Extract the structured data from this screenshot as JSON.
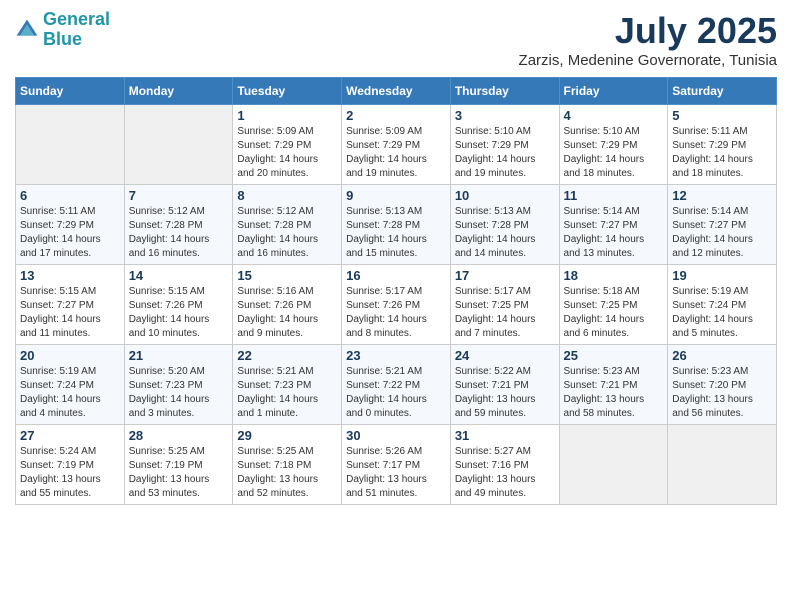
{
  "logo": {
    "line1": "General",
    "line2": "Blue"
  },
  "title": "July 2025",
  "location": "Zarzis, Medenine Governorate, Tunisia",
  "days_of_week": [
    "Sunday",
    "Monday",
    "Tuesday",
    "Wednesday",
    "Thursday",
    "Friday",
    "Saturday"
  ],
  "weeks": [
    [
      {
        "day": "",
        "empty": true
      },
      {
        "day": "",
        "empty": true
      },
      {
        "day": "1",
        "sunrise": "5:09 AM",
        "sunset": "7:29 PM",
        "daylight": "14 hours and 20 minutes."
      },
      {
        "day": "2",
        "sunrise": "5:09 AM",
        "sunset": "7:29 PM",
        "daylight": "14 hours and 19 minutes."
      },
      {
        "day": "3",
        "sunrise": "5:10 AM",
        "sunset": "7:29 PM",
        "daylight": "14 hours and 19 minutes."
      },
      {
        "day": "4",
        "sunrise": "5:10 AM",
        "sunset": "7:29 PM",
        "daylight": "14 hours and 18 minutes."
      },
      {
        "day": "5",
        "sunrise": "5:11 AM",
        "sunset": "7:29 PM",
        "daylight": "14 hours and 18 minutes."
      }
    ],
    [
      {
        "day": "6",
        "sunrise": "5:11 AM",
        "sunset": "7:29 PM",
        "daylight": "14 hours and 17 minutes."
      },
      {
        "day": "7",
        "sunrise": "5:12 AM",
        "sunset": "7:28 PM",
        "daylight": "14 hours and 16 minutes."
      },
      {
        "day": "8",
        "sunrise": "5:12 AM",
        "sunset": "7:28 PM",
        "daylight": "14 hours and 16 minutes."
      },
      {
        "day": "9",
        "sunrise": "5:13 AM",
        "sunset": "7:28 PM",
        "daylight": "14 hours and 15 minutes."
      },
      {
        "day": "10",
        "sunrise": "5:13 AM",
        "sunset": "7:28 PM",
        "daylight": "14 hours and 14 minutes."
      },
      {
        "day": "11",
        "sunrise": "5:14 AM",
        "sunset": "7:27 PM",
        "daylight": "14 hours and 13 minutes."
      },
      {
        "day": "12",
        "sunrise": "5:14 AM",
        "sunset": "7:27 PM",
        "daylight": "14 hours and 12 minutes."
      }
    ],
    [
      {
        "day": "13",
        "sunrise": "5:15 AM",
        "sunset": "7:27 PM",
        "daylight": "14 hours and 11 minutes."
      },
      {
        "day": "14",
        "sunrise": "5:15 AM",
        "sunset": "7:26 PM",
        "daylight": "14 hours and 10 minutes."
      },
      {
        "day": "15",
        "sunrise": "5:16 AM",
        "sunset": "7:26 PM",
        "daylight": "14 hours and 9 minutes."
      },
      {
        "day": "16",
        "sunrise": "5:17 AM",
        "sunset": "7:26 PM",
        "daylight": "14 hours and 8 minutes."
      },
      {
        "day": "17",
        "sunrise": "5:17 AM",
        "sunset": "7:25 PM",
        "daylight": "14 hours and 7 minutes."
      },
      {
        "day": "18",
        "sunrise": "5:18 AM",
        "sunset": "7:25 PM",
        "daylight": "14 hours and 6 minutes."
      },
      {
        "day": "19",
        "sunrise": "5:19 AM",
        "sunset": "7:24 PM",
        "daylight": "14 hours and 5 minutes."
      }
    ],
    [
      {
        "day": "20",
        "sunrise": "5:19 AM",
        "sunset": "7:24 PM",
        "daylight": "14 hours and 4 minutes."
      },
      {
        "day": "21",
        "sunrise": "5:20 AM",
        "sunset": "7:23 PM",
        "daylight": "14 hours and 3 minutes."
      },
      {
        "day": "22",
        "sunrise": "5:21 AM",
        "sunset": "7:23 PM",
        "daylight": "14 hours and 1 minute."
      },
      {
        "day": "23",
        "sunrise": "5:21 AM",
        "sunset": "7:22 PM",
        "daylight": "14 hours and 0 minutes."
      },
      {
        "day": "24",
        "sunrise": "5:22 AM",
        "sunset": "7:21 PM",
        "daylight": "13 hours and 59 minutes."
      },
      {
        "day": "25",
        "sunrise": "5:23 AM",
        "sunset": "7:21 PM",
        "daylight": "13 hours and 58 minutes."
      },
      {
        "day": "26",
        "sunrise": "5:23 AM",
        "sunset": "7:20 PM",
        "daylight": "13 hours and 56 minutes."
      }
    ],
    [
      {
        "day": "27",
        "sunrise": "5:24 AM",
        "sunset": "7:19 PM",
        "daylight": "13 hours and 55 minutes."
      },
      {
        "day": "28",
        "sunrise": "5:25 AM",
        "sunset": "7:19 PM",
        "daylight": "13 hours and 53 minutes."
      },
      {
        "day": "29",
        "sunrise": "5:25 AM",
        "sunset": "7:18 PM",
        "daylight": "13 hours and 52 minutes."
      },
      {
        "day": "30",
        "sunrise": "5:26 AM",
        "sunset": "7:17 PM",
        "daylight": "13 hours and 51 minutes."
      },
      {
        "day": "31",
        "sunrise": "5:27 AM",
        "sunset": "7:16 PM",
        "daylight": "13 hours and 49 minutes."
      },
      {
        "day": "",
        "empty": true
      },
      {
        "day": "",
        "empty": true
      }
    ]
  ],
  "labels": {
    "sunrise": "Sunrise:",
    "sunset": "Sunset:",
    "daylight": "Daylight:"
  }
}
